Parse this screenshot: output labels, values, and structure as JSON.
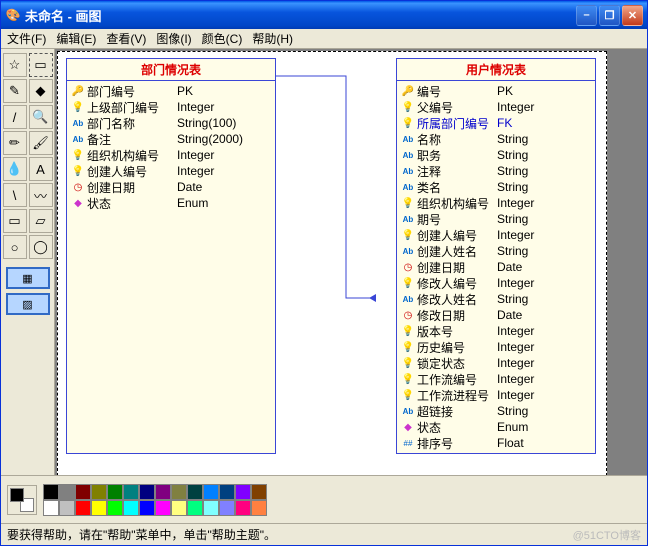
{
  "window": {
    "title": "未命名 - 画图"
  },
  "menu": {
    "file": "文件(F)",
    "edit": "编辑(E)",
    "view": "查看(V)",
    "image": "图像(I)",
    "color": "颜色(C)",
    "help": "帮助(H)"
  },
  "entity1": {
    "title": "部门情况表",
    "rows": [
      {
        "icon": "🔑",
        "name": "部门编号",
        "type": "PK"
      },
      {
        "icon": "💡",
        "name": "上级部门编号",
        "type": "Integer"
      },
      {
        "icon": "Abc",
        "name": "部门名称",
        "type": "String(100)"
      },
      {
        "icon": "Abc",
        "name": "备注",
        "type": "String(2000)"
      },
      {
        "icon": "💡",
        "name": "组织机构编号",
        "type": "Integer"
      },
      {
        "icon": "💡",
        "name": "创建人编号",
        "type": "Integer"
      },
      {
        "icon": "⏱",
        "name": "创建日期",
        "type": "Date"
      },
      {
        "icon": "◆",
        "name": "状态",
        "type": "Enum"
      }
    ]
  },
  "entity2": {
    "title": "用户情况表",
    "rows": [
      {
        "icon": "🔑",
        "name": "编号",
        "type": "PK"
      },
      {
        "icon": "💡",
        "name": "父编号",
        "type": "Integer"
      },
      {
        "icon": "💡",
        "name": "所属部门编号",
        "type": "FK",
        "fk": true
      },
      {
        "icon": "Abc",
        "name": "名称",
        "type": "String"
      },
      {
        "icon": "Abc",
        "name": "职务",
        "type": "String"
      },
      {
        "icon": "Abc",
        "name": "注释",
        "type": "String"
      },
      {
        "icon": "Abc",
        "name": "类名",
        "type": "String"
      },
      {
        "icon": "💡",
        "name": "组织机构编号",
        "type": "Integer"
      },
      {
        "icon": "Abc",
        "name": "期号",
        "type": "String"
      },
      {
        "icon": "💡",
        "name": "创建人编号",
        "type": "Integer"
      },
      {
        "icon": "Abc",
        "name": "创建人姓名",
        "type": "String"
      },
      {
        "icon": "⏱",
        "name": "创建日期",
        "type": "Date"
      },
      {
        "icon": "💡",
        "name": "修改人编号",
        "type": "Integer"
      },
      {
        "icon": "Abc",
        "name": "修改人姓名",
        "type": "String"
      },
      {
        "icon": "⏱",
        "name": "修改日期",
        "type": "Date"
      },
      {
        "icon": "💡",
        "name": "版本号",
        "type": "Integer"
      },
      {
        "icon": "💡",
        "name": "历史编号",
        "type": "Integer"
      },
      {
        "icon": "💡",
        "name": "锁定状态",
        "type": "Integer"
      },
      {
        "icon": "💡",
        "name": "工作流编号",
        "type": "Integer"
      },
      {
        "icon": "💡",
        "name": "工作流进程号",
        "type": "Integer"
      },
      {
        "icon": "Abc",
        "name": "超链接",
        "type": "String"
      },
      {
        "icon": "◆",
        "name": "状态",
        "type": "Enum"
      },
      {
        "icon": "###",
        "name": "排序号",
        "type": "Float"
      }
    ]
  },
  "palette": {
    "row1": [
      "#000000",
      "#808080",
      "#800000",
      "#808000",
      "#008000",
      "#008080",
      "#000080",
      "#800080",
      "#808040",
      "#004040",
      "#0080ff",
      "#004080",
      "#8000ff",
      "#804000"
    ],
    "row2": [
      "#ffffff",
      "#c0c0c0",
      "#ff0000",
      "#ffff00",
      "#00ff00",
      "#00ffff",
      "#0000ff",
      "#ff00ff",
      "#ffff80",
      "#00ff80",
      "#80ffff",
      "#8080ff",
      "#ff0080",
      "#ff8040"
    ]
  },
  "status": {
    "text": "要获得帮助，请在\"帮助\"菜单中，单击\"帮助主题\"。",
    "watermark": "@51CTO博客"
  },
  "tools": [
    "☆",
    "▭",
    "✎",
    "◆",
    "/",
    "🔍",
    "✏",
    "🖌",
    "💧",
    "A",
    "\\",
    "〰",
    "▭",
    "▱",
    "○",
    "◯"
  ]
}
